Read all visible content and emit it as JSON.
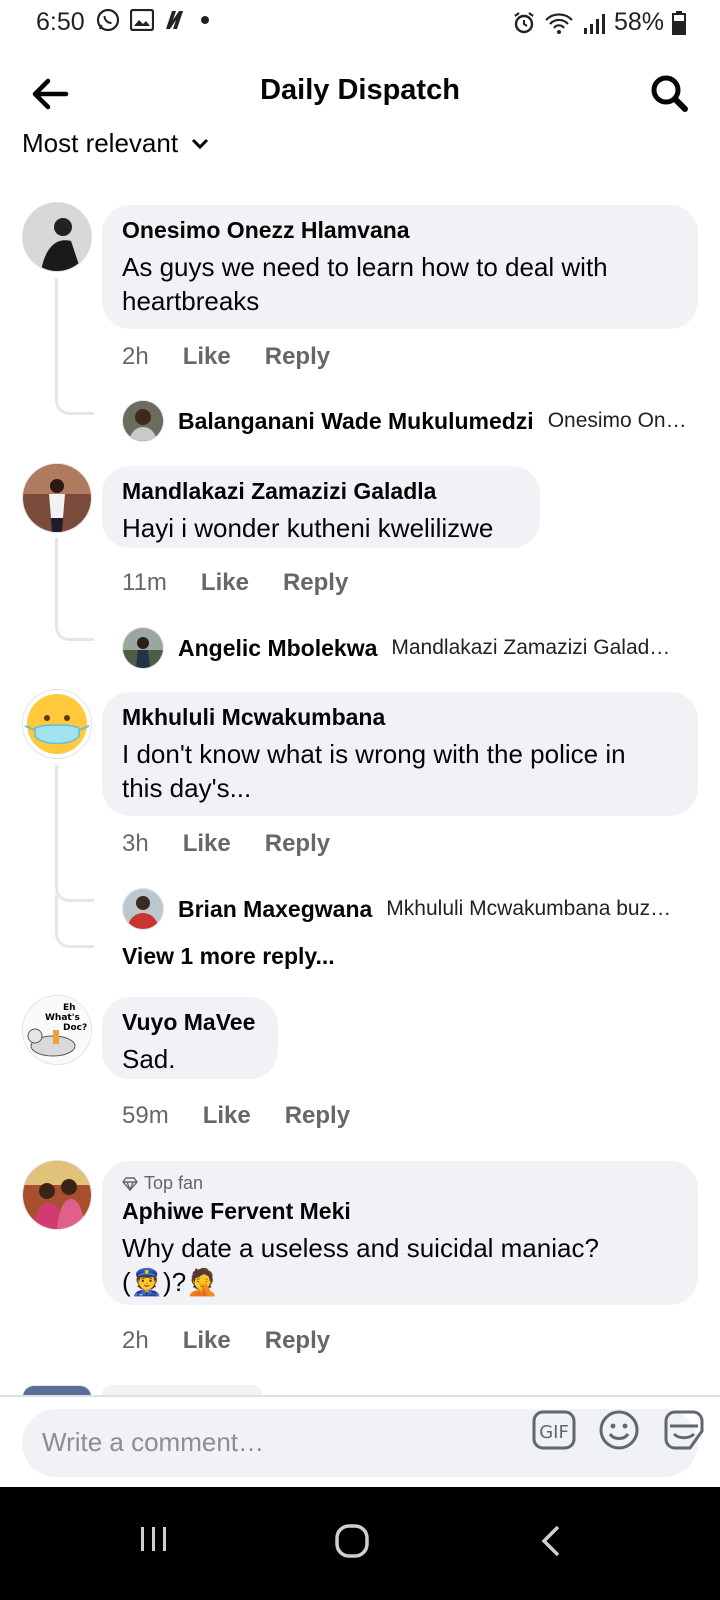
{
  "status_bar": {
    "time": "6:50",
    "battery": "58%"
  },
  "header": {
    "title": "Daily Dispatch"
  },
  "sort": {
    "label": "Most relevant"
  },
  "comments": [
    {
      "name": "Onesimo Onezz Hlamvana",
      "text_lines": [
        "As guys we  need to learn how to deal with",
        "heartbreaks"
      ],
      "time": "2h",
      "like": "Like",
      "reply": "Reply",
      "reply_preview": {
        "name": "Balanganani Wade Mukulumedzi",
        "text": "Onesimo On…"
      }
    },
    {
      "name": "Mandlakazi Zamazizi Galadla",
      "text_lines": [
        "Hayi i wonder kutheni kwelilizwe"
      ],
      "time": "11m",
      "like": "Like",
      "reply": "Reply",
      "reply_preview": {
        "name": "Angelic Mbolekwa",
        "text": "Mandlakazi Zamazizi Galad…"
      }
    },
    {
      "name": "Mkhululi Mcwakumbana",
      "text_lines": [
        "I don't know what is wrong with the police in",
        "this day's..."
      ],
      "time": "3h",
      "like": "Like",
      "reply": "Reply",
      "reply_preview": {
        "name": "Brian Maxegwana",
        "text": "Mkhululi Mcwakumbana buz…"
      },
      "view_more": "View 1 more reply..."
    },
    {
      "name": "Vuyo MaVee",
      "text_lines": [
        "Sad."
      ],
      "time": "59m",
      "like": "Like",
      "reply": "Reply"
    },
    {
      "badge": "Top fan",
      "name": "Aphiwe Fervent Meki",
      "text_lines": [
        "Why date a useless and suicidal maniac?",
        "(👮)?🤦"
      ],
      "time": "2h",
      "like": "Like",
      "reply": "Reply"
    }
  ],
  "avatar_text": {
    "vuyo": [
      "Eh",
      "What's",
      "Doc?"
    ]
  },
  "composer": {
    "placeholder": "Write a comment…",
    "gif_label": "GIF"
  },
  "colors": {
    "bubble": "#f0f2f5",
    "meta": "#65676b",
    "thread_line": "#e4e6eb"
  }
}
